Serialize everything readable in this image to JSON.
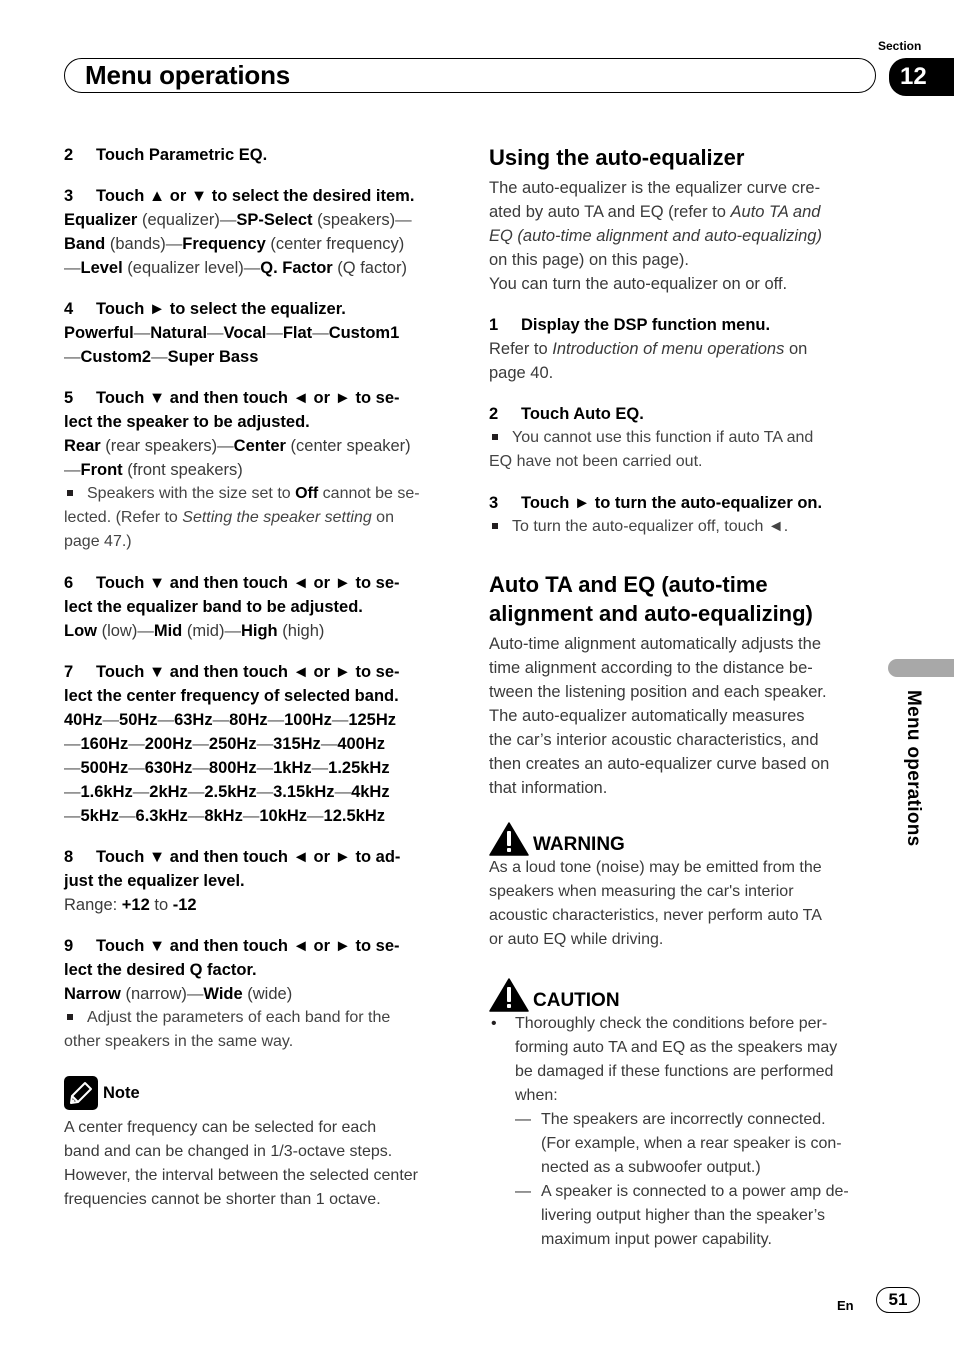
{
  "header": {
    "section_label": "Section",
    "section_number": "12",
    "title": "Menu operations"
  },
  "left": {
    "step2": {
      "num": "2",
      "text": "Touch Parametric EQ."
    },
    "step3": {
      "num": "3",
      "text": "Touch ▲ or ▼ to select the desired item.",
      "items": [
        {
          "name": "Equalizer",
          "desc": "(equalizer)"
        },
        {
          "name": "SP-Select",
          "desc": "(speakers)"
        },
        {
          "name": "Band",
          "desc": "(bands)"
        },
        {
          "name": "Frequency",
          "desc": "(center frequency)"
        },
        {
          "name": "Level",
          "desc": "(equalizer level)"
        },
        {
          "name": "Q. Factor",
          "desc": "(Q factor)"
        }
      ]
    },
    "step4": {
      "num": "4",
      "text": "Touch ► to select the equalizer.",
      "options": [
        "Powerful",
        "Natural",
        "Vocal",
        "Flat",
        "Custom1",
        "Custom2",
        "Super Bass"
      ]
    },
    "step5": {
      "num": "5",
      "text_line1": "Touch ▼ and then touch ◄ or ► to se-",
      "text_line2": "lect the speaker to be adjusted.",
      "items": [
        {
          "name": "Rear",
          "desc": "(rear speakers)"
        },
        {
          "name": "Center",
          "desc": "(center speaker)"
        },
        {
          "name": "Front",
          "desc": "(front speakers)"
        }
      ],
      "bullet_pre": "Speakers with the size set to ",
      "bullet_bold": "Off",
      "bullet_mid": " cannot be se-",
      "bullet_line2_pre": "lected. (Refer to ",
      "bullet_italic": "Setting the speaker setting",
      "bullet_post": " on",
      "bullet_line3": "page 47.)"
    },
    "step6": {
      "num": "6",
      "text_line1": "Touch ▼ and then touch ◄ or ► to se-",
      "text_line2": "lect the equalizer band to be adjusted.",
      "items": [
        {
          "name": "Low",
          "desc": "(low)"
        },
        {
          "name": "Mid",
          "desc": "(mid)"
        },
        {
          "name": "High",
          "desc": "(high)"
        }
      ]
    },
    "step7": {
      "num": "7",
      "text_line1": "Touch ▼ and then touch ◄ or ► to se-",
      "text_line2": "lect the center frequency of selected band.",
      "frequency_rows": [
        [
          "40Hz",
          "50Hz",
          "63Hz",
          "80Hz",
          "100Hz",
          "125Hz"
        ],
        [
          "160Hz",
          "200Hz",
          "250Hz",
          "315Hz",
          "400Hz"
        ],
        [
          "500Hz",
          "630Hz",
          "800Hz",
          "1kHz",
          "1.25kHz"
        ],
        [
          "1.6kHz",
          "2kHz",
          "2.5kHz",
          "3.15kHz",
          "4kHz"
        ],
        [
          "5kHz",
          "6.3kHz",
          "8kHz",
          "10kHz",
          "12.5kHz"
        ]
      ]
    },
    "step8": {
      "num": "8",
      "text_line1": "Touch ▼ and then touch ◄ or ► to ad-",
      "text_line2": "just the equalizer level.",
      "range_label": "Range: ",
      "range_max": "+12",
      "range_to": " to ",
      "range_min": "-12"
    },
    "step9": {
      "num": "9",
      "text_line1": "Touch ▼ and then touch ◄ or ► to se-",
      "text_line2": "lect the desired Q factor.",
      "items": [
        {
          "name": "Narrow",
          "desc": "(narrow)"
        },
        {
          "name": "Wide",
          "desc": "(wide)"
        }
      ],
      "bullet_line1": "Adjust the parameters of each band for the",
      "bullet_line2": "other speakers in the same way."
    },
    "note": {
      "title": "Note",
      "lines": [
        "A center frequency can be selected for each",
        "band and can be changed in 1/3-octave steps.",
        "However, the interval between the selected center",
        "frequencies cannot be shorter than 1 octave."
      ]
    }
  },
  "right": {
    "auto_eq": {
      "heading": "Using the auto-equalizer",
      "p1_line1": "The auto-equalizer is the equalizer curve cre-",
      "p1_line2_pre": "ated by auto TA and EQ (refer to ",
      "p1_line2_italic": "Auto TA and",
      "p1_line3_italic": "EQ (auto-time alignment and auto-equalizing)",
      "p1_line4": "on this page) on this page).",
      "p2": "You can turn the auto-equalizer on or off.",
      "step1": {
        "num": "1",
        "text": "Display the DSP function menu."
      },
      "step1_ref_pre": "Refer to ",
      "step1_ref_italic": "Introduction of menu operations",
      "step1_ref_post": " on",
      "step1_ref_line2": "page 40.",
      "step2": {
        "num": "2",
        "text": "Touch Auto EQ."
      },
      "step2_bullet_line1": "You cannot use this function if auto TA and",
      "step2_bullet_line2": "EQ have not been carried out.",
      "step3": {
        "num": "3",
        "text": "Touch ► to turn the auto-equalizer on."
      },
      "step3_bullet": "To turn the auto-equalizer off, touch ◄."
    },
    "auto_ta": {
      "heading_line1": "Auto TA and EQ (auto-time",
      "heading_line2": "alignment and auto-equalizing)",
      "lines": [
        "Auto-time alignment automatically adjusts the",
        "time alignment according to the distance be-",
        "tween the listening position and each speaker.",
        "The auto-equalizer automatically measures",
        "the car’s interior acoustic characteristics, and",
        "then creates an auto-equalizer curve based on",
        "that information."
      ]
    },
    "warning": {
      "title": "WARNING",
      "lines": [
        "As a loud tone (noise) may be emitted from the",
        "speakers when measuring the car's interior",
        "acoustic characteristics, never perform auto TA",
        "or auto EQ while driving."
      ]
    },
    "caution": {
      "title": "CAUTION",
      "bullet_lines": [
        "Thoroughly check the conditions before per-",
        "forming auto TA and EQ as the speakers may",
        "be damaged if these functions are performed",
        "when:"
      ],
      "sub_items": [
        {
          "lines": [
            "The speakers are incorrectly connected.",
            "(For example, when a rear speaker is con-",
            "nected as a subwoofer output.)"
          ]
        },
        {
          "lines": [
            "A speaker is connected to a power amp de-",
            "livering output higher than the speaker’s",
            "maximum input power capability."
          ]
        }
      ]
    }
  },
  "side_tab": {
    "label": "Menu operations"
  },
  "footer": {
    "language": "En",
    "page_number": "51"
  }
}
